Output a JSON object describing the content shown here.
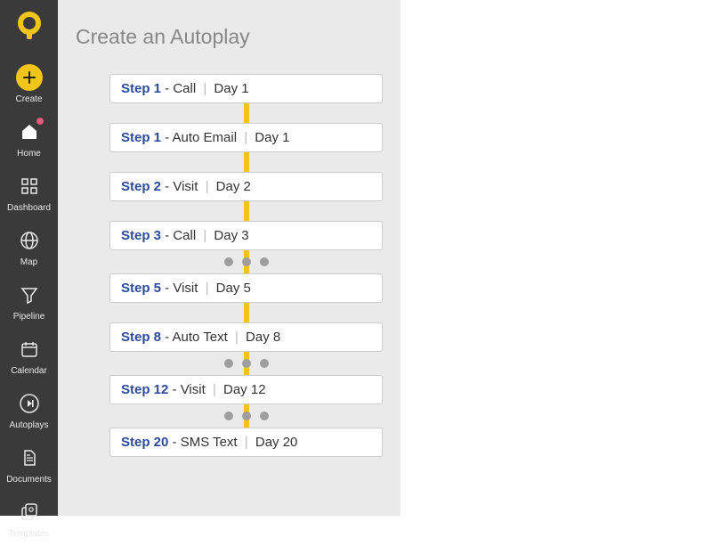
{
  "sidebar": {
    "items": [
      {
        "label": "Create"
      },
      {
        "label": "Home"
      },
      {
        "label": "Dashboard"
      },
      {
        "label": "Map"
      },
      {
        "label": "Pipeline"
      },
      {
        "label": "Calendar"
      },
      {
        "label": "Autoplays"
      },
      {
        "label": "Documents"
      },
      {
        "label": "Templates"
      }
    ]
  },
  "main": {
    "title": "Create an Autoplay",
    "steps": [
      {
        "num": "Step 1",
        "action": "Call",
        "day": "Day 1",
        "connector": "line"
      },
      {
        "num": "Step 1",
        "action": "Auto Email",
        "day": "Day 1",
        "connector": "line"
      },
      {
        "num": "Step 2",
        "action": "Visit",
        "day": "Day 2",
        "connector": "line"
      },
      {
        "num": "Step 3",
        "action": "Call",
        "day": "Day 3",
        "connector": "dots"
      },
      {
        "num": "Step 5",
        "action": "Visit",
        "day": "Day 5",
        "connector": "line"
      },
      {
        "num": "Step 8",
        "action": "Auto Text",
        "day": "Day 8",
        "connector": "dots"
      },
      {
        "num": "Step 12",
        "action": "Visit",
        "day": "Day 12",
        "connector": "dots"
      },
      {
        "num": "Step 20",
        "action": "SMS Text",
        "day": "Day 20",
        "connector": null
      }
    ]
  }
}
